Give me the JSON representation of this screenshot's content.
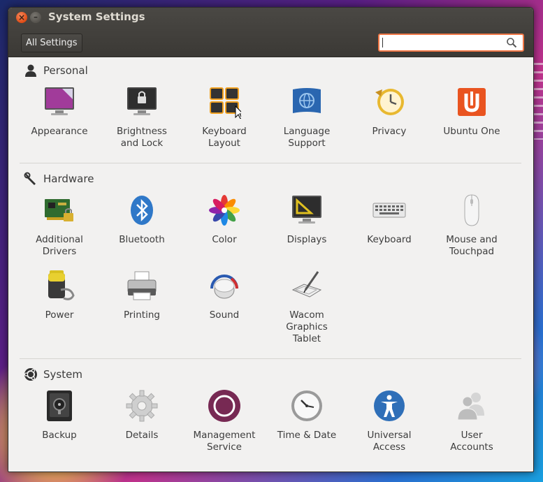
{
  "window": {
    "title": "System Settings"
  },
  "toolbar": {
    "all_settings_label": "All Settings",
    "search_value": ""
  },
  "sections": {
    "personal": {
      "title": "Personal",
      "items": [
        {
          "label": "Appearance"
        },
        {
          "label": "Brightness\nand Lock"
        },
        {
          "label": "Keyboard\nLayout"
        },
        {
          "label": "Language\nSupport"
        },
        {
          "label": "Privacy"
        },
        {
          "label": "Ubuntu One"
        }
      ]
    },
    "hardware": {
      "title": "Hardware",
      "items": [
        {
          "label": "Additional\nDrivers"
        },
        {
          "label": "Bluetooth"
        },
        {
          "label": "Color"
        },
        {
          "label": "Displays"
        },
        {
          "label": "Keyboard"
        },
        {
          "label": "Mouse and\nTouchpad"
        },
        {
          "label": "Power"
        },
        {
          "label": "Printing"
        },
        {
          "label": "Sound"
        },
        {
          "label": "Wacom\nGraphics\nTablet"
        }
      ]
    },
    "system": {
      "title": "System",
      "items": [
        {
          "label": "Backup"
        },
        {
          "label": "Details"
        },
        {
          "label": "Management\nService"
        },
        {
          "label": "Time & Date"
        },
        {
          "label": "Universal\nAccess"
        },
        {
          "label": "User\nAccounts"
        }
      ]
    }
  },
  "colors": {
    "accent": "#f07746",
    "titlebar": "#3b3935",
    "background": "#f2f1f0"
  }
}
